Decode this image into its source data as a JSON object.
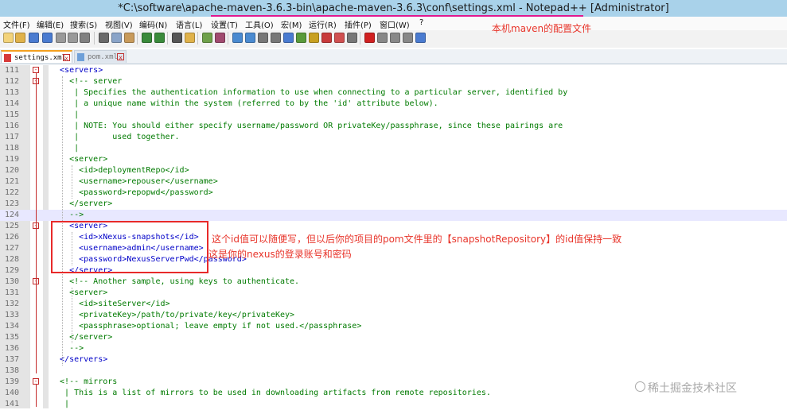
{
  "window": {
    "title": "*C:\\software\\apache-maven-3.6.3-bin\\apache-maven-3.6.3\\conf\\settings.xml - Notepad++ [Administrator]"
  },
  "menu": [
    "文件(F)",
    "编辑(E)",
    "搜索(S)",
    "视图(V)",
    "编码(N)",
    "语言(L)",
    "设置(T)",
    "工具(O)",
    "宏(M)",
    "运行(R)",
    "插件(P)",
    "窗口(W)",
    "?"
  ],
  "tabs": [
    {
      "label": "settings.xml",
      "active": true
    },
    {
      "label": "pom.xml",
      "active": false
    }
  ],
  "annotations": {
    "top": "本机maven的配置文件",
    "id_note": "这个id值可以随便写，但以后你的项目的pom文件里的【snapshotRepository】的id值保持一致",
    "account_note": "这是你的nexus的登录账号和密码"
  },
  "code_lines": [
    {
      "n": "111",
      "text": "  <servers>"
    },
    {
      "n": "112",
      "text": "    <!-- server"
    },
    {
      "n": "113",
      "text": "     | Specifies the authentication information to use when connecting to a particular server, identified by"
    },
    {
      "n": "114",
      "text": "     | a unique name within the system (referred to by the 'id' attribute below)."
    },
    {
      "n": "115",
      "text": "     |"
    },
    {
      "n": "116",
      "text": "     | NOTE: You should either specify username/password OR privateKey/passphrase, since these pairings are"
    },
    {
      "n": "117",
      "text": "     |       used together."
    },
    {
      "n": "118",
      "text": "     |"
    },
    {
      "n": "119",
      "text": "    <server>"
    },
    {
      "n": "120",
      "text": "      <id>deploymentRepo</id>"
    },
    {
      "n": "121",
      "text": "      <username>repouser</username>"
    },
    {
      "n": "122",
      "text": "      <password>repopwd</password>"
    },
    {
      "n": "123",
      "text": "    </server>"
    },
    {
      "n": "124",
      "text": "    -->"
    },
    {
      "n": "125",
      "text": "    <server>"
    },
    {
      "n": "126",
      "text": "      <id>xNexus-snapshots</id>"
    },
    {
      "n": "127",
      "text": "      <username>admin</username>"
    },
    {
      "n": "128",
      "text": "      <password>NexusServerPwd</password>"
    },
    {
      "n": "129",
      "text": "    </server>"
    },
    {
      "n": "130",
      "text": "    <!-- Another sample, using keys to authenticate."
    },
    {
      "n": "131",
      "text": "    <server>"
    },
    {
      "n": "132",
      "text": "      <id>siteServer</id>"
    },
    {
      "n": "133",
      "text": "      <privateKey>/path/to/private/key</privateKey>"
    },
    {
      "n": "134",
      "text": "      <passphrase>optional; leave empty if not used.</passphrase>"
    },
    {
      "n": "135",
      "text": "    </server>"
    },
    {
      "n": "136",
      "text": "    -->"
    },
    {
      "n": "137",
      "text": "  </servers>"
    },
    {
      "n": "138",
      "text": ""
    },
    {
      "n": "139",
      "text": "  <!-- mirrors"
    },
    {
      "n": "140",
      "text": "   | This is a list of mirrors to be used in downloading artifacts from remote repositories."
    },
    {
      "n": "141",
      "text": "   |"
    }
  ],
  "watermark": "稀土掘金技术社区"
}
